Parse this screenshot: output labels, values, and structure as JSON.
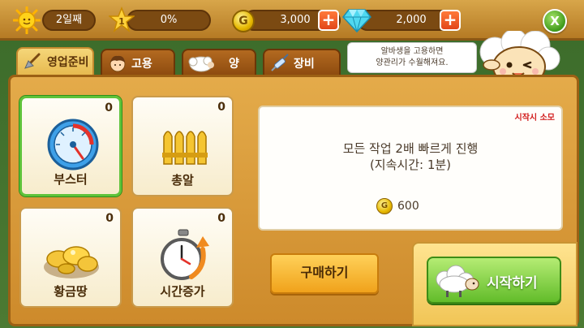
{
  "top_bar": {
    "day": "2일째",
    "progress_percent": "0%",
    "coins": "3,000",
    "gems": "2,000",
    "star_level": "1",
    "coin_symbol": "G",
    "plus": "+",
    "close": "X"
  },
  "tabs": [
    {
      "label": "영업준비",
      "active": true
    },
    {
      "label": "고용",
      "active": false
    },
    {
      "label": "양",
      "active": false
    },
    {
      "label": "장비",
      "active": false
    }
  ],
  "tooltip": {
    "line1": "알바생을 고용하면",
    "line2": "양관리가 수월해져요."
  },
  "items": [
    {
      "label": "부스터",
      "count": "0",
      "icon": "gauge-icon",
      "selected": true
    },
    {
      "label": "총알",
      "count": "0",
      "icon": "bullets-icon",
      "selected": false
    },
    {
      "label": "황금땅",
      "count": "0",
      "icon": "gold-land-icon",
      "selected": false
    },
    {
      "label": "시간증가",
      "count": "0",
      "icon": "stopwatch-icon",
      "selected": false
    }
  ],
  "description": {
    "cost_label": "시작시 소모",
    "line1": "모든 작업 2배 빠르게 진행",
    "line2": "(지속시간: 1분)",
    "coin_symbol": "G",
    "price": "600"
  },
  "buttons": {
    "buy": "구매하기",
    "start": "시작하기"
  },
  "colors": {
    "panel": "#e4ab4a",
    "selected_border": "#5ec33a",
    "buy_button": "#f0a21b",
    "start_button": "#62bc2a",
    "cost_label": "#d11b1b"
  }
}
